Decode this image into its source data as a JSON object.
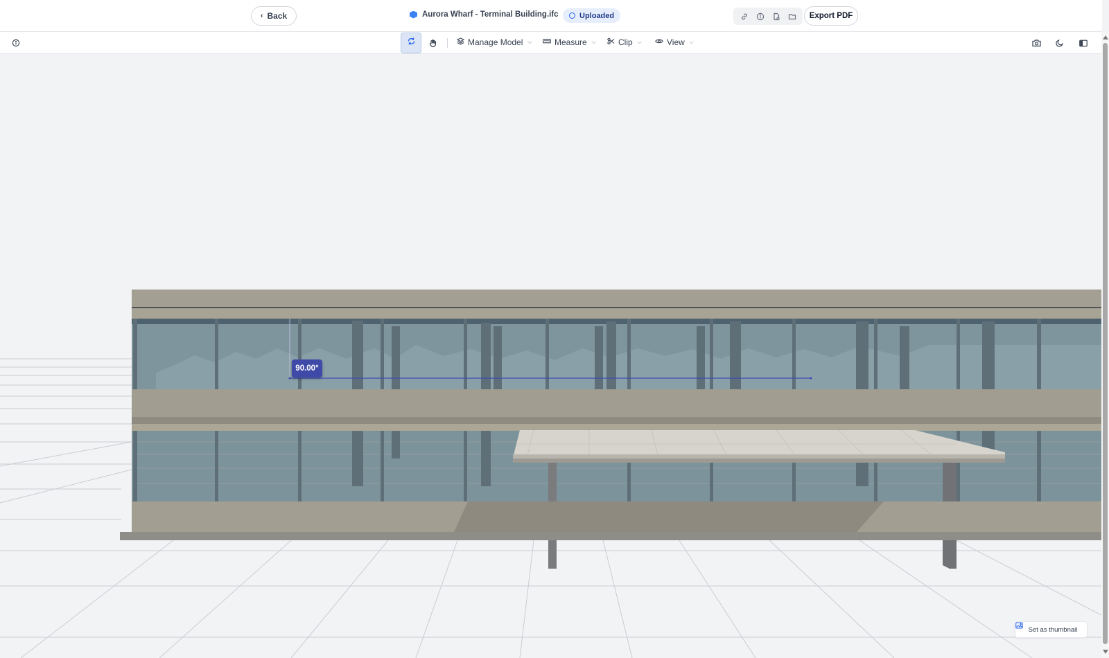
{
  "header": {
    "back_label": "Back",
    "file_name": "Aurora Wharf - Terminal Building.ifc",
    "status": "Uploaded",
    "export_label": "Export PDF",
    "icons": [
      "link-icon",
      "info-icon",
      "file-icon",
      "folder-icon"
    ]
  },
  "toolbar": {
    "menus": {
      "manage_model": "Manage Model",
      "measure": "Measure",
      "clip": "Clip",
      "view": "View"
    },
    "icons": [
      "info-icon",
      "orbit-icon",
      "pan-hand-icon",
      "camera-icon",
      "moon-icon",
      "sidebar-toggle-icon"
    ]
  },
  "viewport": {
    "angle_measurement": "90.00°",
    "thumbnail_label": "Set as thumbnail"
  },
  "colors": {
    "accent": "#3f4aa8",
    "status_bg": "#e7eefb",
    "building_concrete": "#a19d90",
    "glass": "#7c929c",
    "background": "#f2f3f5"
  }
}
